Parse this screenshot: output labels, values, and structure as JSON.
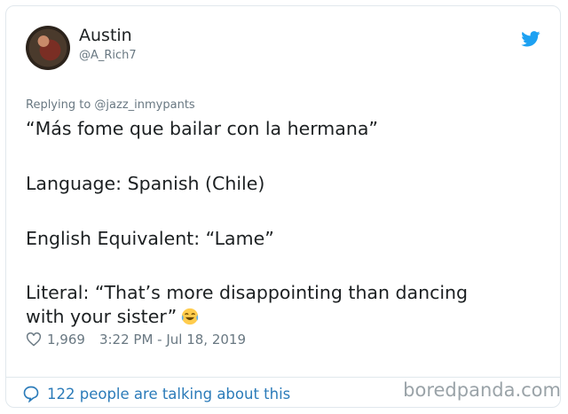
{
  "tweet": {
    "author_name": "Austin",
    "author_handle": "@A_Rich7",
    "replying_to": "Replying to @jazz_inmypants",
    "lines": [
      "“Más fome que bailar con la hermana”",
      "Language: Spanish (Chile)",
      "English Equivalent: “Lame”",
      "Literal: “That’s more disappointing than dancing",
      "with your sister”"
    ],
    "likes": "1,969",
    "timestamp": "3:22 PM - Jul 18, 2019",
    "talking": "122 people are talking about this"
  },
  "watermark": "boredpanda.com",
  "colors": {
    "accent": "#1da1f2",
    "link": "#2b7bb9",
    "muted": "#697882"
  },
  "icons": [
    "twitter-bird-icon",
    "heart-icon",
    "speech-bubble-icon",
    "laughing-tears-emoji"
  ]
}
